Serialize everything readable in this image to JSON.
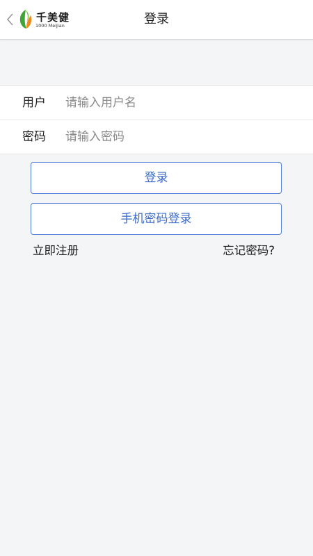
{
  "navbar": {
    "title": "登录",
    "back_icon": "chevron-left-icon",
    "logo": {
      "name_cn": "千美健",
      "name_en": "1000 MeiJian",
      "colors": {
        "green": "#3fa535",
        "orange": "#f08a1c"
      }
    }
  },
  "form": {
    "username": {
      "label": "用户",
      "placeholder": "请输入用户名",
      "value": ""
    },
    "password": {
      "label": "密码",
      "placeholder": "请输入密码",
      "value": ""
    }
  },
  "buttons": {
    "login_label": "登录",
    "phone_login_label": "手机密码登录"
  },
  "links": {
    "register": "立即注册",
    "forgot": "忘记密码?"
  },
  "colors": {
    "accent": "#4d7bd3",
    "background": "#f4f5f7"
  }
}
